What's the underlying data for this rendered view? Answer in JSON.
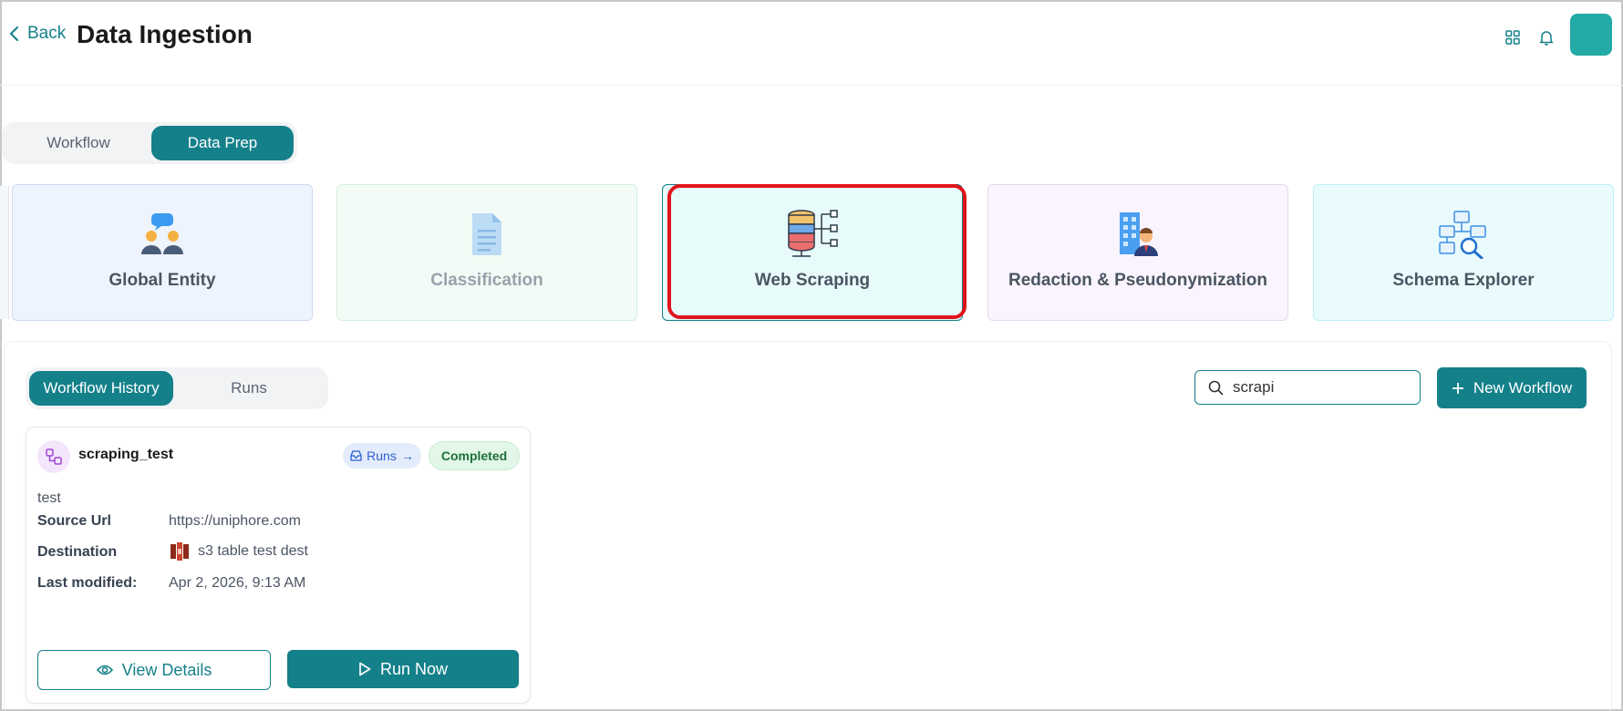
{
  "header": {
    "back_label": "Back",
    "title": "Data Ingestion",
    "icons": [
      "grid-icon",
      "bell-icon"
    ],
    "accent_color": "#14808a"
  },
  "top_tabs": [
    {
      "label": "Workflow",
      "active": false
    },
    {
      "label": "Data Prep",
      "active": true
    }
  ],
  "feature_cards": [
    {
      "label": "Global Entity",
      "icon": "people-chat-icon",
      "bg": "#eef4fd",
      "border": "#c9d8f2"
    },
    {
      "label": "Classification",
      "icon": "document-icon",
      "bg": "#f3fbf6",
      "border": "#d4eedd"
    },
    {
      "label": "Web Scraping",
      "icon": "database-tree-icon",
      "bg": "#e8fbfb",
      "border": "#14808a",
      "selected": true
    },
    {
      "label": "Redaction & Pseudonymization",
      "icon": "office-person-icon",
      "bg": "#f9f4fd",
      "border": "#e8d9f2"
    },
    {
      "label": "Schema Explorer",
      "icon": "schema-search-icon",
      "bg": "#e9fbfd",
      "border": "#bfeef4"
    }
  ],
  "history_tabs": [
    {
      "label": "Workflow History",
      "active": true
    },
    {
      "label": "Runs",
      "active": false
    }
  ],
  "search": {
    "value": "scrapi",
    "placeholder": "Search"
  },
  "new_workflow_label": "New Workflow",
  "workflow": {
    "name": "scraping_test",
    "runs_label": "Runs",
    "status": "Completed",
    "description": "test",
    "source_url_label": "Source Url",
    "source_url": "https://uniphore.com",
    "destination_label": "Destination",
    "destination": "s3 table test dest",
    "modified_label": "Last modified:",
    "modified": "Apr 2, 2026, 9:13 AM",
    "view_details_label": "View Details",
    "run_now_label": "Run Now"
  }
}
